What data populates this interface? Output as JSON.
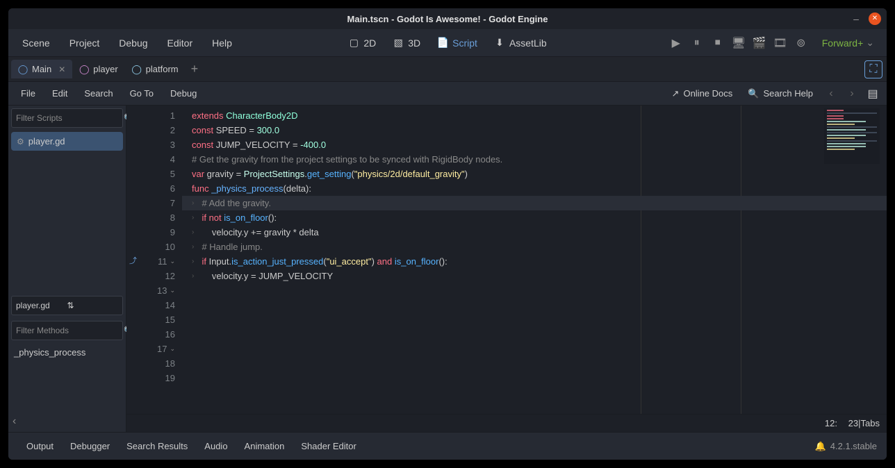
{
  "window": {
    "title": "Main.tscn - Godot Is Awesome! - Godot Engine"
  },
  "menubar": {
    "items": [
      "Scene",
      "Project",
      "Debug",
      "Editor",
      "Help"
    ]
  },
  "mode_switcher": {
    "btn_2d": "2D",
    "btn_3d": "3D",
    "btn_script": "Script",
    "btn_assetlib": "AssetLib"
  },
  "renderer": "Forward+",
  "scene_tabs": [
    {
      "label": "Main",
      "active": true,
      "icon_color": "#6a9fd9"
    },
    {
      "label": "player",
      "active": false,
      "icon_color": "#d08ad0"
    },
    {
      "label": "platform",
      "active": false,
      "icon_color": "#8ecae6"
    }
  ],
  "script_menubar": {
    "items": [
      "File",
      "Edit",
      "Search",
      "Go To",
      "Debug"
    ],
    "online_docs": "Online Docs",
    "search_help": "Search Help"
  },
  "filters": {
    "scripts_placeholder": "Filter Scripts",
    "methods_placeholder": "Filter Methods"
  },
  "scripts_list": [
    "player.gd"
  ],
  "current_script": "player.gd",
  "methods_list": [
    "_physics_process"
  ],
  "code": {
    "lines": [
      {
        "n": 1,
        "t": [
          [
            "extends ",
            "kw"
          ],
          [
            "CharacterBody2D",
            "type"
          ]
        ]
      },
      {
        "n": 2,
        "t": []
      },
      {
        "n": 3,
        "t": []
      },
      {
        "n": 4,
        "t": [
          [
            "const ",
            "kw"
          ],
          [
            "SPEED = ",
            ""
          ],
          [
            "300.0",
            "num"
          ]
        ]
      },
      {
        "n": 5,
        "t": [
          [
            "const ",
            "kw"
          ],
          [
            "JUMP_VELOCITY = ",
            ""
          ],
          [
            "-400.0",
            "num"
          ]
        ]
      },
      {
        "n": 6,
        "t": []
      },
      {
        "n": 7,
        "t": [
          [
            "# Get the gravity from the project settings to be synced with RigidBody nodes.",
            "comment"
          ]
        ]
      },
      {
        "n": 8,
        "t": [
          [
            "var ",
            "kw"
          ],
          [
            "gravity = ",
            ""
          ],
          [
            "ProjectSettings",
            "class"
          ],
          [
            ".",
            ""
          ],
          [
            "get_setting",
            "builtin"
          ],
          [
            "(",
            ""
          ],
          [
            "\"physics/2d/default_gravity\"",
            "str"
          ],
          [
            ")",
            ""
          ]
        ]
      },
      {
        "n": 9,
        "t": []
      },
      {
        "n": 10,
        "t": []
      },
      {
        "n": 11,
        "t": [
          [
            "func ",
            "kw"
          ],
          [
            "_physics_process",
            "func"
          ],
          [
            "(delta):",
            ""
          ]
        ],
        "fold": true,
        "override": true
      },
      {
        "n": 12,
        "t": [
          [
            "    ",
            ""
          ],
          [
            "# Add the gravity.",
            "comment"
          ]
        ],
        "current": true,
        "guide": 1
      },
      {
        "n": 13,
        "t": [
          [
            "    ",
            ""
          ],
          [
            "if ",
            "kw"
          ],
          [
            "not ",
            "kw"
          ],
          [
            "is_on_floor",
            "builtin"
          ],
          [
            "():",
            ""
          ]
        ],
        "fold": true,
        "guide": 1
      },
      {
        "n": 14,
        "t": [
          [
            "        velocity.y += gravity * delta",
            ""
          ]
        ],
        "guide": 2
      },
      {
        "n": 15,
        "t": []
      },
      {
        "n": 16,
        "t": [
          [
            "    ",
            ""
          ],
          [
            "# Handle jump.",
            "comment"
          ]
        ],
        "guide": 1
      },
      {
        "n": 17,
        "t": [
          [
            "    ",
            ""
          ],
          [
            "if ",
            "kw"
          ],
          [
            "Input.",
            ""
          ],
          [
            "is_action_just_pressed",
            "builtin"
          ],
          [
            "(",
            ""
          ],
          [
            "\"ui_accept\"",
            "str"
          ],
          [
            ") ",
            ""
          ],
          [
            "and ",
            "kw"
          ],
          [
            "is_on_floor",
            "builtin"
          ],
          [
            "():",
            ""
          ]
        ],
        "fold": true,
        "guide": 1
      },
      {
        "n": 18,
        "t": [
          [
            "        velocity.y = JUMP_VELOCITY",
            ""
          ]
        ],
        "guide": 2
      },
      {
        "n": 19,
        "t": []
      }
    ]
  },
  "status": {
    "line": "12",
    "col": "23",
    "sep1": " : ",
    "sep2": " | ",
    "indent": "Tabs"
  },
  "bottom_panel": {
    "tabs": [
      "Output",
      "Debugger",
      "Search Results",
      "Audio",
      "Animation",
      "Shader Editor"
    ],
    "version": "4.2.1.stable"
  }
}
